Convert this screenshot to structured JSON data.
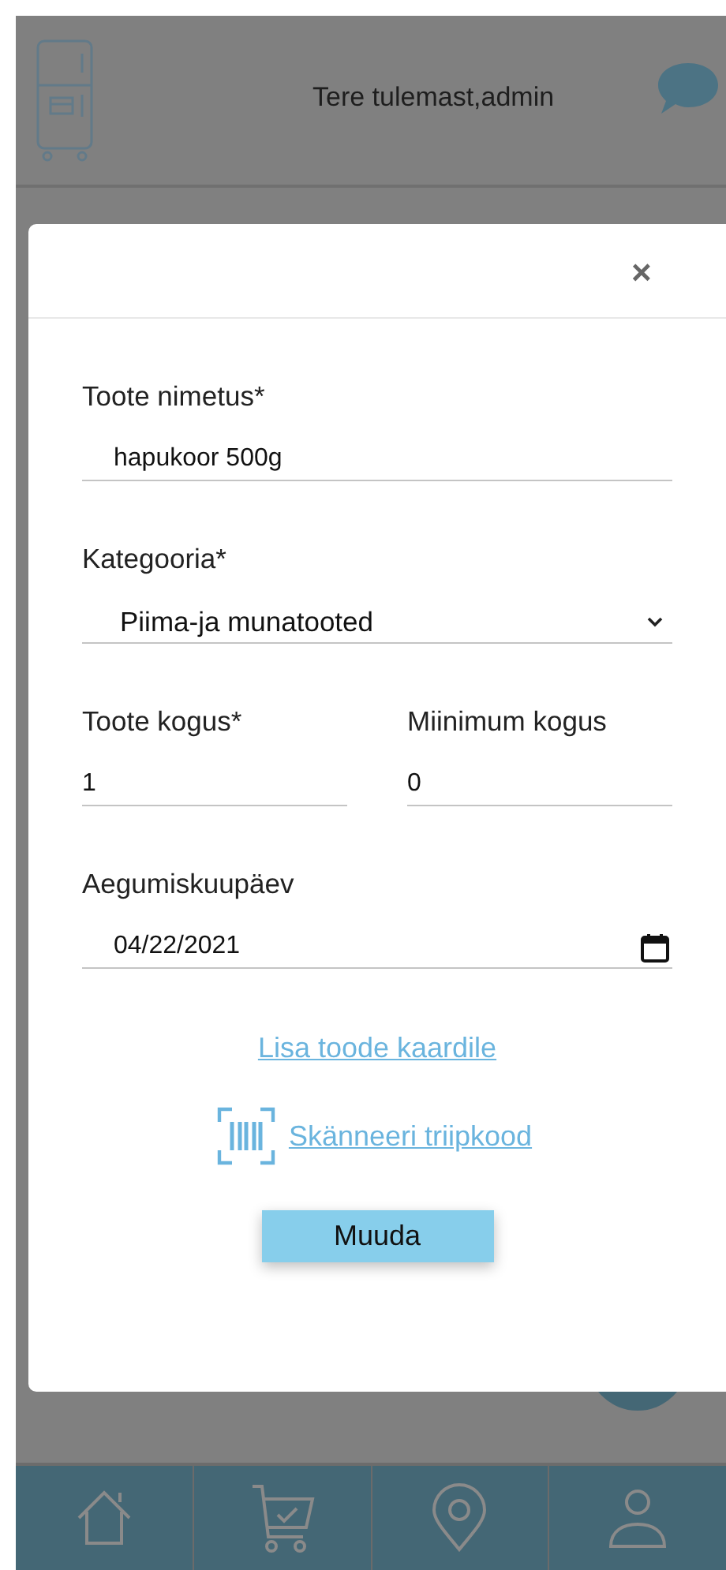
{
  "header": {
    "greeting": "Tere tulemast,admin"
  },
  "modal": {
    "close": "×",
    "fields": [
      {
        "kind": "text",
        "label": "Toote nimetus*",
        "value": "hapukoor 500g"
      },
      {
        "kind": "select",
        "label": "Kategooria*",
        "value": "Piima-ja munatooted"
      }
    ],
    "pair": [
      {
        "label": "Toote kogus*",
        "value": "1"
      },
      {
        "label": "Miinimum kogus",
        "value": "0"
      }
    ],
    "date": {
      "label": "Aegumiskuupäev",
      "value": "04/22/2021"
    },
    "links": [
      {
        "kind": "plain",
        "text": "Lisa toode kaardile"
      },
      {
        "kind": "barcode",
        "text": "Skänneeri triipkood"
      }
    ],
    "submit": "Muuda"
  },
  "nav": [
    {
      "kind": "home"
    },
    {
      "kind": "cart"
    },
    {
      "kind": "pin"
    },
    {
      "kind": "user"
    }
  ]
}
